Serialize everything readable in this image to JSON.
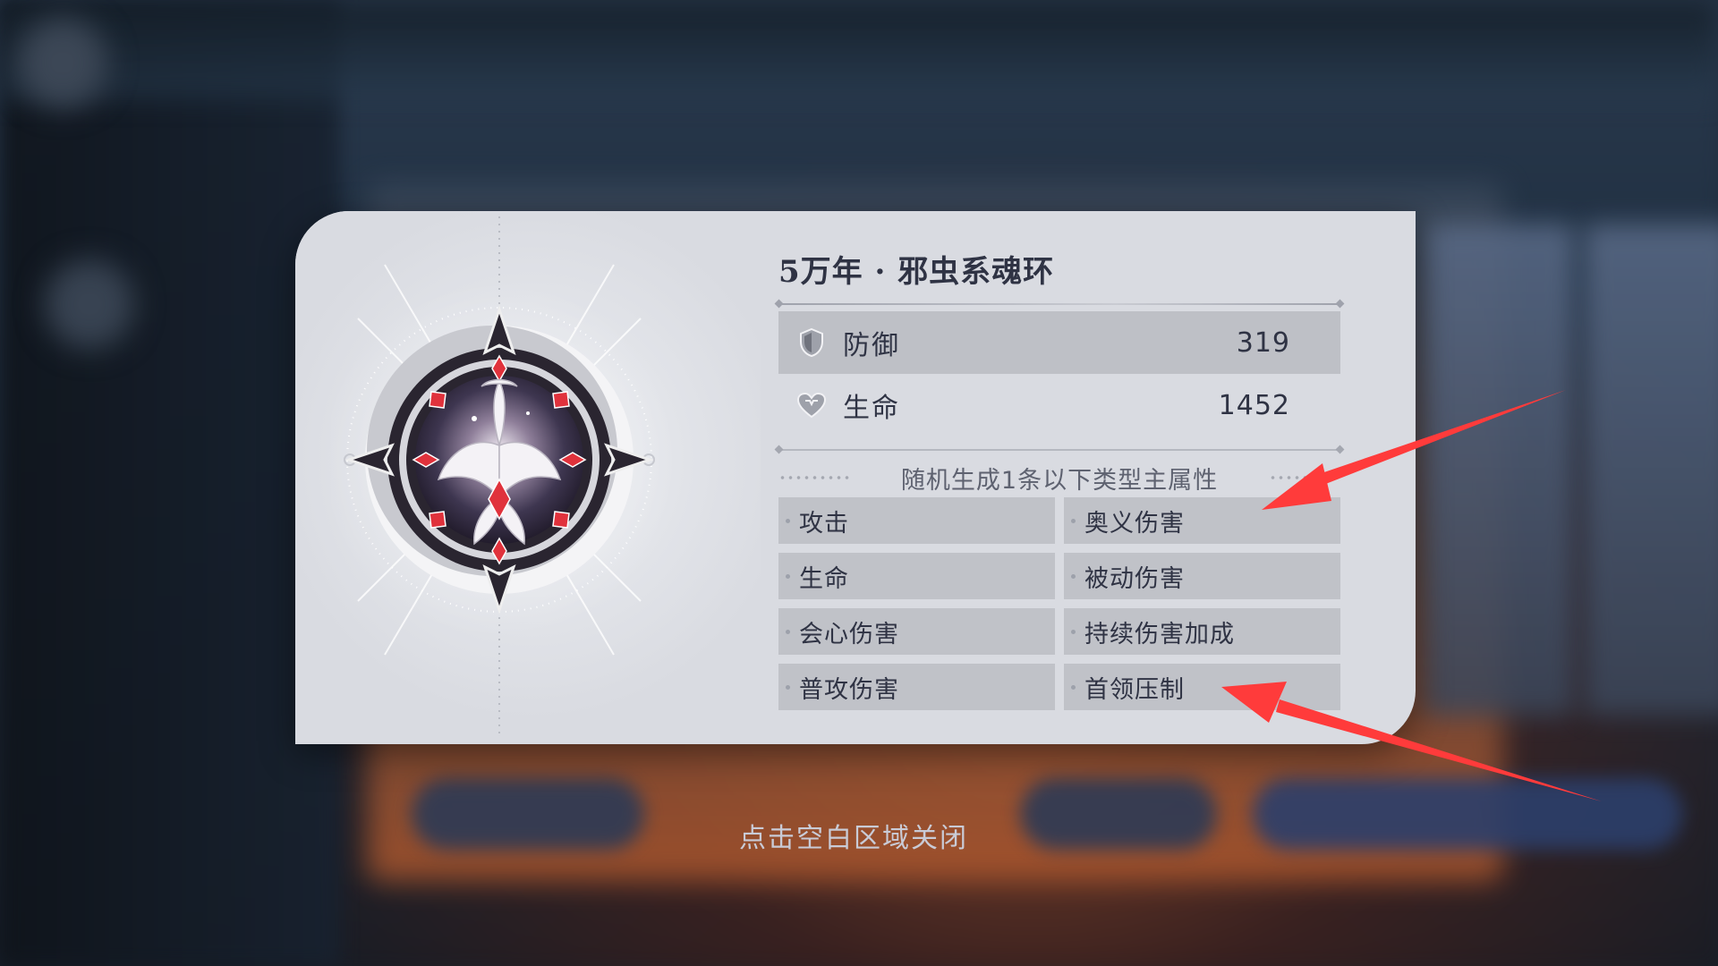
{
  "item": {
    "title": "5万年 · 邪虫系魂环",
    "icon": "evil-insect-soul-ring-emblem"
  },
  "stats": [
    {
      "icon": "shield-icon",
      "label": "防御",
      "value": "319"
    },
    {
      "icon": "heart-icon",
      "label": "生命",
      "value": "1452"
    }
  ],
  "random_attributes": {
    "heading": "随机生成1条以下类型主属性",
    "left": [
      "攻击",
      "生命",
      "会心伤害",
      "普攻伤害"
    ],
    "right": [
      "奥义伤害",
      "被动伤害",
      "持续伤害加成",
      "首领压制"
    ]
  },
  "close_hint": "点击空白区域关闭",
  "annotation": {
    "arrow_color": "#ff3b3b",
    "arrows_point_to": [
      "奥义伤害",
      "首领压制"
    ]
  },
  "colors": {
    "modal_bg": "#d9dbe1",
    "row_shade": "#bec0c6",
    "text_dark": "#2f3344",
    "accent_red": "#e0323c"
  }
}
